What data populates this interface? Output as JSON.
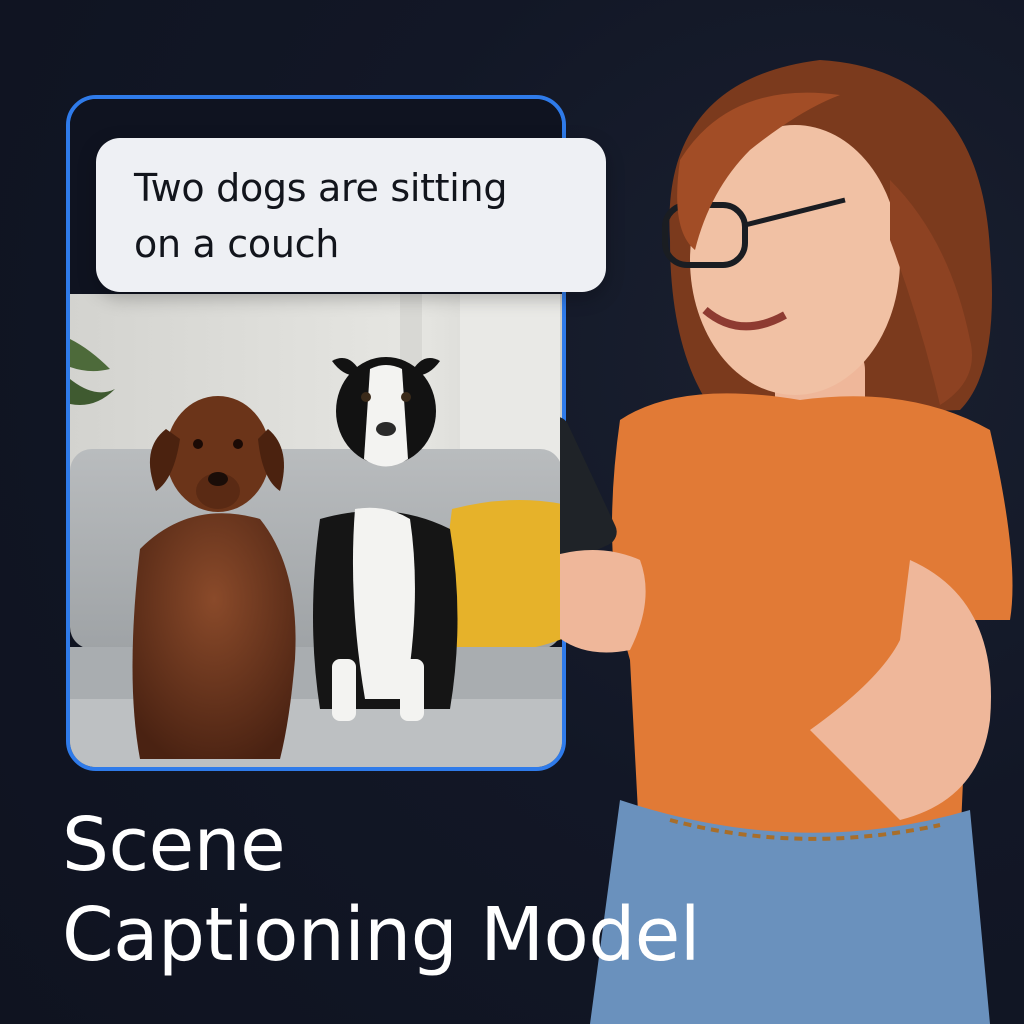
{
  "caption": {
    "text": "Two dogs are sitting\non a couch"
  },
  "title": {
    "line1": "Scene",
    "line2": "Captioning Model"
  },
  "colors": {
    "background": "#111522",
    "frame_blue": "#2f7bea",
    "bubble_bg": "#eef0f4",
    "shirt_orange": "#e17a36",
    "jeans_blue": "#6a91bd"
  },
  "icons": {
    "phone": "smartphone-icon"
  }
}
